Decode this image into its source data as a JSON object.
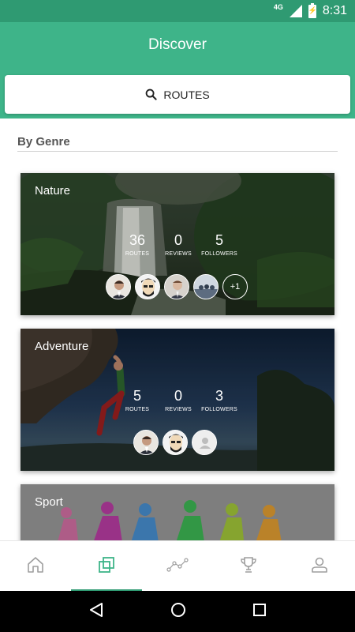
{
  "status_bar": {
    "network": "4G",
    "time": "8:31"
  },
  "app_bar": {
    "title": "Discover"
  },
  "search": {
    "label": "ROUTES",
    "icon": "search-icon"
  },
  "section": {
    "title": "By Genre"
  },
  "genres": [
    {
      "name": "Nature",
      "stats": [
        {
          "value": "36",
          "label": "ROUTES"
        },
        {
          "value": "0",
          "label": "REVIEWS"
        },
        {
          "value": "5",
          "label": "FOLLOWERS"
        }
      ],
      "more_followers": "+1"
    },
    {
      "name": "Adventure",
      "stats": [
        {
          "value": "5",
          "label": "ROUTES"
        },
        {
          "value": "0",
          "label": "REVIEWS"
        },
        {
          "value": "3",
          "label": "FOLLOWERS"
        }
      ]
    },
    {
      "name": "Sport"
    }
  ],
  "bottom_nav": {
    "items": [
      "home-icon",
      "genres-icon",
      "route-icon",
      "trophy-icon",
      "profile-icon"
    ],
    "active_index": 1
  },
  "colors": {
    "primary": "#3eb489",
    "primary_dark": "#2f9a72"
  }
}
